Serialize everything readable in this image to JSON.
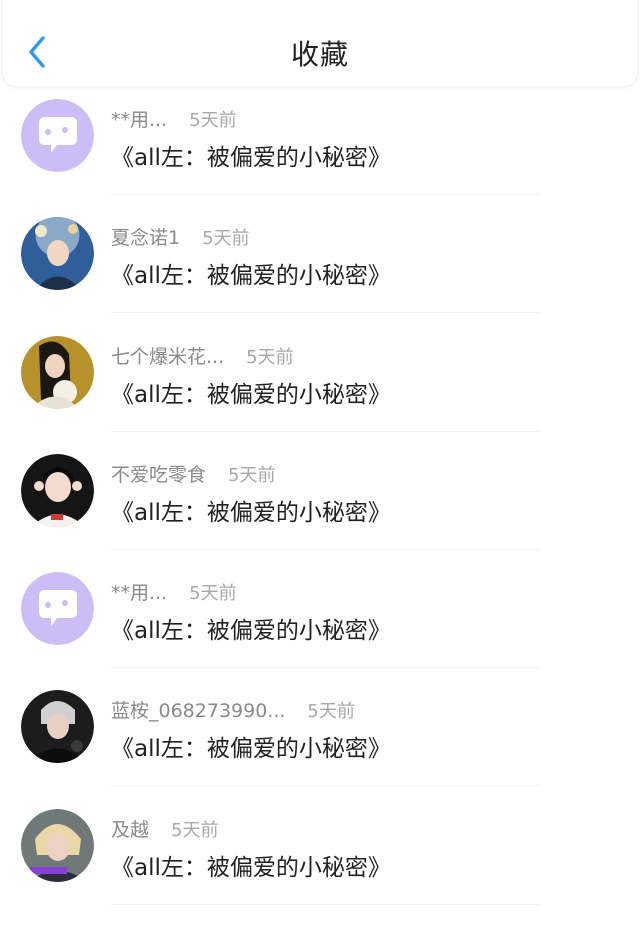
{
  "header": {
    "title": "收藏"
  },
  "colors": {
    "accent": "#2f9bf0",
    "default_avatar_bg": "#cdbcf5"
  },
  "favorites": [
    {
      "user": "**用...",
      "time": "5天前",
      "title": "《all左：被偏爱的小秘密》",
      "avatar": "default-avatar-icon"
    },
    {
      "user": "夏念诺1",
      "time": "5天前",
      "title": "《all左：被偏爱的小秘密》",
      "avatar": "user-photo"
    },
    {
      "user": "七个爆米花...",
      "time": "5天前",
      "title": "《all左：被偏爱的小秘密》",
      "avatar": "user-photo"
    },
    {
      "user": "不爱吃零食",
      "time": "5天前",
      "title": "《all左：被偏爱的小秘密》",
      "avatar": "user-photo"
    },
    {
      "user": "**用...",
      "time": "5天前",
      "title": "《all左：被偏爱的小秘密》",
      "avatar": "default-avatar-icon"
    },
    {
      "user": "蓝桉_068273990...",
      "time": "5天前",
      "title": "《all左：被偏爱的小秘密》",
      "avatar": "user-photo"
    },
    {
      "user": "及越",
      "time": "5天前",
      "title": "《all左：被偏爱的小秘密》",
      "avatar": "user-photo"
    }
  ]
}
